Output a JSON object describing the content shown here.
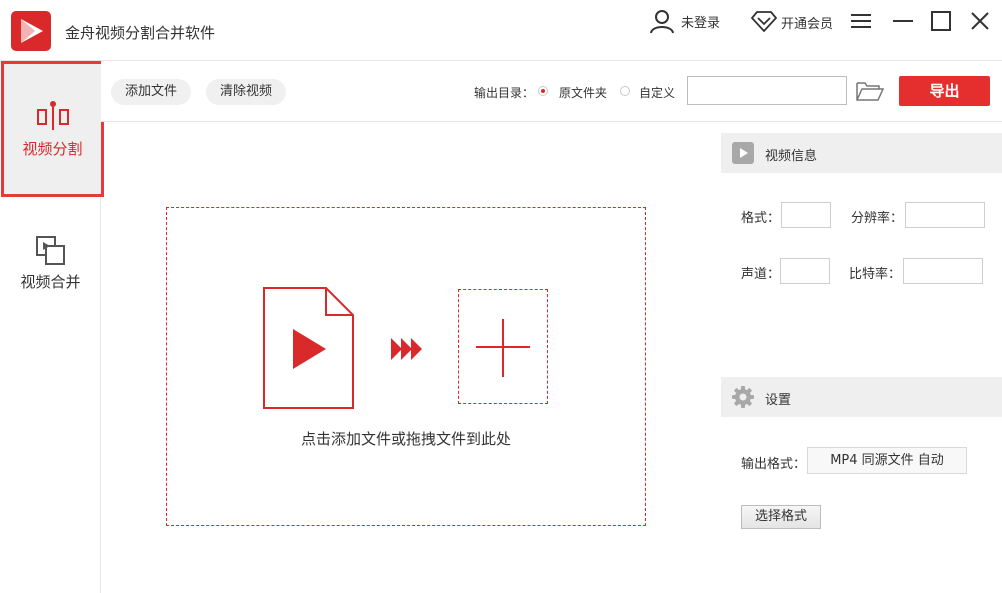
{
  "app": {
    "title": "金舟视频分割合并软件"
  },
  "titlebar": {
    "user_label": "未登录",
    "vip_label": "开通会员"
  },
  "sidebar": {
    "items": [
      {
        "label": "视频分割",
        "icon": "split-icon",
        "active": true
      },
      {
        "label": "视频合并",
        "icon": "merge-icon",
        "active": false
      }
    ]
  },
  "toolbar": {
    "add_file": "添加文件",
    "clear_video": "清除视频",
    "output_dir_label": "输出目录：",
    "option_source": "原文件夹",
    "option_custom": "自定义",
    "selected_option": "原文件夹",
    "path_value": "",
    "export_label": "导出"
  },
  "dropzone": {
    "hint": "点击添加文件或拖拽文件到此处"
  },
  "video_info": {
    "title": "视频信息",
    "format_label": "格式：",
    "resolution_label": "分辨率：",
    "channel_label": "声道：",
    "bitrate_label": "比特率：",
    "format_value": "",
    "resolution_value": "",
    "channel_value": "",
    "bitrate_value": ""
  },
  "settings": {
    "title": "设置",
    "output_format_label": "输出格式：",
    "output_format_value": "MP4 同源文件 自动",
    "select_format_label": "选择格式"
  },
  "colors": {
    "accent": "#d9292b",
    "export_button": "#e52e2e"
  }
}
